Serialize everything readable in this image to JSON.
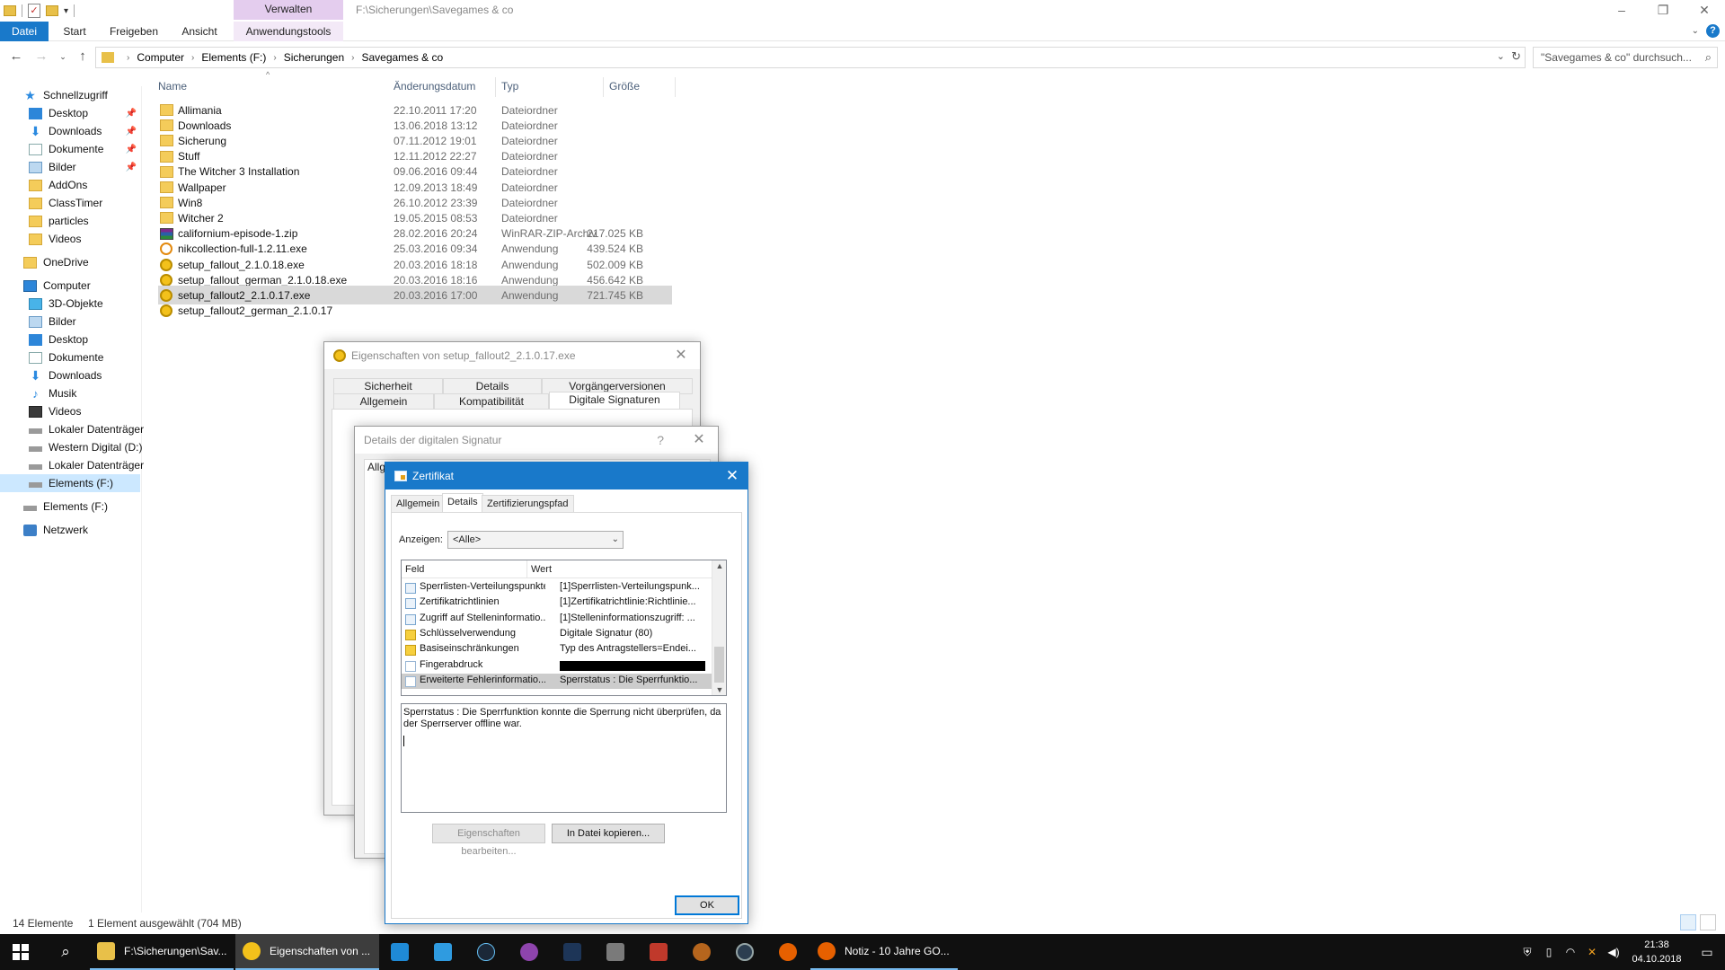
{
  "explorer": {
    "ribbon_context_group": "Verwalten",
    "window_title": "F:\\Sicherungen\\Savegames & co",
    "ribbon_tabs": [
      {
        "label": "Datei"
      },
      {
        "label": "Start"
      },
      {
        "label": "Freigeben"
      },
      {
        "label": "Ansicht"
      },
      {
        "label": "Anwendungstools"
      }
    ],
    "breadcrumb": [
      "Computer",
      "Elements (F:)",
      "Sicherungen",
      "Savegames & co"
    ],
    "search_placeholder": "\"Savegames & co\" durchsuch...",
    "columns": {
      "name": "Name",
      "date": "Änderungsdatum",
      "type": "Typ",
      "size": "Größe"
    },
    "files": [
      {
        "name": "Allimania",
        "date": "22.10.2011 17:20",
        "type": "Dateiordner",
        "size": "",
        "icon": "folder-icon"
      },
      {
        "name": "Downloads",
        "date": "13.06.2018 13:12",
        "type": "Dateiordner",
        "size": "",
        "icon": "folder-icon"
      },
      {
        "name": "Sicherung",
        "date": "07.11.2012 19:01",
        "type": "Dateiordner",
        "size": "",
        "icon": "folder-icon"
      },
      {
        "name": "Stuff",
        "date": "12.11.2012 22:27",
        "type": "Dateiordner",
        "size": "",
        "icon": "folder-icon"
      },
      {
        "name": "The Witcher 3 Installation",
        "date": "09.06.2016 09:44",
        "type": "Dateiordner",
        "size": "",
        "icon": "folder-icon"
      },
      {
        "name": "Wallpaper",
        "date": "12.09.2013 18:49",
        "type": "Dateiordner",
        "size": "",
        "icon": "folder-icon"
      },
      {
        "name": "Win8",
        "date": "26.10.2012 23:39",
        "type": "Dateiordner",
        "size": "",
        "icon": "folder-icon"
      },
      {
        "name": "Witcher 2",
        "date": "19.05.2015 08:53",
        "type": "Dateiordner",
        "size": "",
        "icon": "folder-icon"
      },
      {
        "name": "californium-episode-1.zip",
        "date": "28.02.2016 20:24",
        "type": "WinRAR-ZIP-Archiv",
        "size": "217.025 KB",
        "icon": "zip-icon"
      },
      {
        "name": "nikcollection-full-1.2.11.exe",
        "date": "25.03.2016 09:34",
        "type": "Anwendung",
        "size": "439.524 KB",
        "icon": "exe-icon"
      },
      {
        "name": "setup_fallout_2.1.0.18.exe",
        "date": "20.03.2016 18:18",
        "type": "Anwendung",
        "size": "502.009 KB",
        "icon": "exe-icon"
      },
      {
        "name": "setup_fallout_german_2.1.0.18.exe",
        "date": "20.03.2016 18:16",
        "type": "Anwendung",
        "size": "456.642 KB",
        "icon": "exe-icon"
      },
      {
        "name": "setup_fallout2_2.1.0.17.exe",
        "date": "20.03.2016 17:00",
        "type": "Anwendung",
        "size": "721.745 KB",
        "icon": "exe-icon",
        "selected": true
      },
      {
        "name": "setup_fallout2_german_2.1.0.17",
        "date": "",
        "type": "",
        "size": "",
        "icon": "exe-icon"
      }
    ],
    "nav": {
      "quick_access": "Schnellzugriff",
      "quick_items": [
        "Desktop",
        "Downloads",
        "Dokumente",
        "Bilder",
        "AddOns",
        "ClassTimer",
        "particles",
        "Videos"
      ],
      "onedrive": "OneDrive",
      "computer": "Computer",
      "computer_items": [
        "3D-Objekte",
        "Bilder",
        "Desktop",
        "Dokumente",
        "Downloads",
        "Musik",
        "Videos",
        "Lokaler Datenträger",
        "Western Digital (D:)",
        "Lokaler Datenträger",
        "Elements (F:)"
      ],
      "elements": "Elements (F:)",
      "network": "Netzwerk"
    },
    "status": {
      "count": "14 Elemente",
      "selection": "1 Element ausgewählt (704 MB)"
    }
  },
  "props_dialog": {
    "title": "Eigenschaften von setup_fallout2_2.1.0.17.exe",
    "tabs_row1": [
      "Sicherheit",
      "Details",
      "Vorgängerversionen"
    ],
    "tabs_row2": [
      "Allgemein",
      "Kompatibilität",
      "Digitale Signaturen"
    ]
  },
  "sig_dialog": {
    "title": "Details der digitalen Signatur",
    "help": "?",
    "tab_partial": "Allg"
  },
  "cert_dialog": {
    "title": "Zertifikat",
    "tabs": [
      "Allgemein",
      "Details",
      "Zertifizierungspfad"
    ],
    "show_label": "Anzeigen:",
    "show_value": "<Alle>",
    "col_field": "Feld",
    "col_value": "Wert",
    "rows": [
      {
        "field": "Sperrlisten-Verteilungspunkte",
        "value": "[1]Sperrlisten-Verteilungspunk...",
        "icon": "ext"
      },
      {
        "field": "Zertifikatrichtlinien",
        "value": "[1]Zertifikatrichtlinie:Richtlinie...",
        "icon": "ext"
      },
      {
        "field": "Zugriff auf Stelleninformatio...",
        "value": "[1]Stelleninformationszugriff: ...",
        "icon": "ext"
      },
      {
        "field": "Schlüsselverwendung",
        "value": "Digitale Signatur (80)",
        "icon": "warn"
      },
      {
        "field": "Basiseinschränkungen",
        "value": "Typ des Antragstellers=Endei...",
        "icon": "warn"
      },
      {
        "field": "Fingerabdruck",
        "value": "",
        "icon": "doc",
        "redacted": true
      },
      {
        "field": "Erweiterte Fehlerinformatio...",
        "value": "Sperrstatus : Die Sperrfunktio...",
        "icon": "doc",
        "selected": true
      }
    ],
    "detail_text_line1": "Sperrstatus : Die Sperrfunktion konnte die Sperrung nicht überprüfen, da",
    "detail_text_line2": "der Sperrserver offline war.",
    "edit_button": "Eigenschaften bearbeiten...",
    "copy_button": "In Datei kopieren...",
    "ok_button": "OK"
  },
  "taskbar": {
    "explorer_window": "F:\\Sicherungen\\Sav...",
    "props_window": "Eigenschaften von ...",
    "firefox_window": "Notiz - 10 Jahre GO...",
    "time": "21:38",
    "date": "04.10.2018"
  }
}
